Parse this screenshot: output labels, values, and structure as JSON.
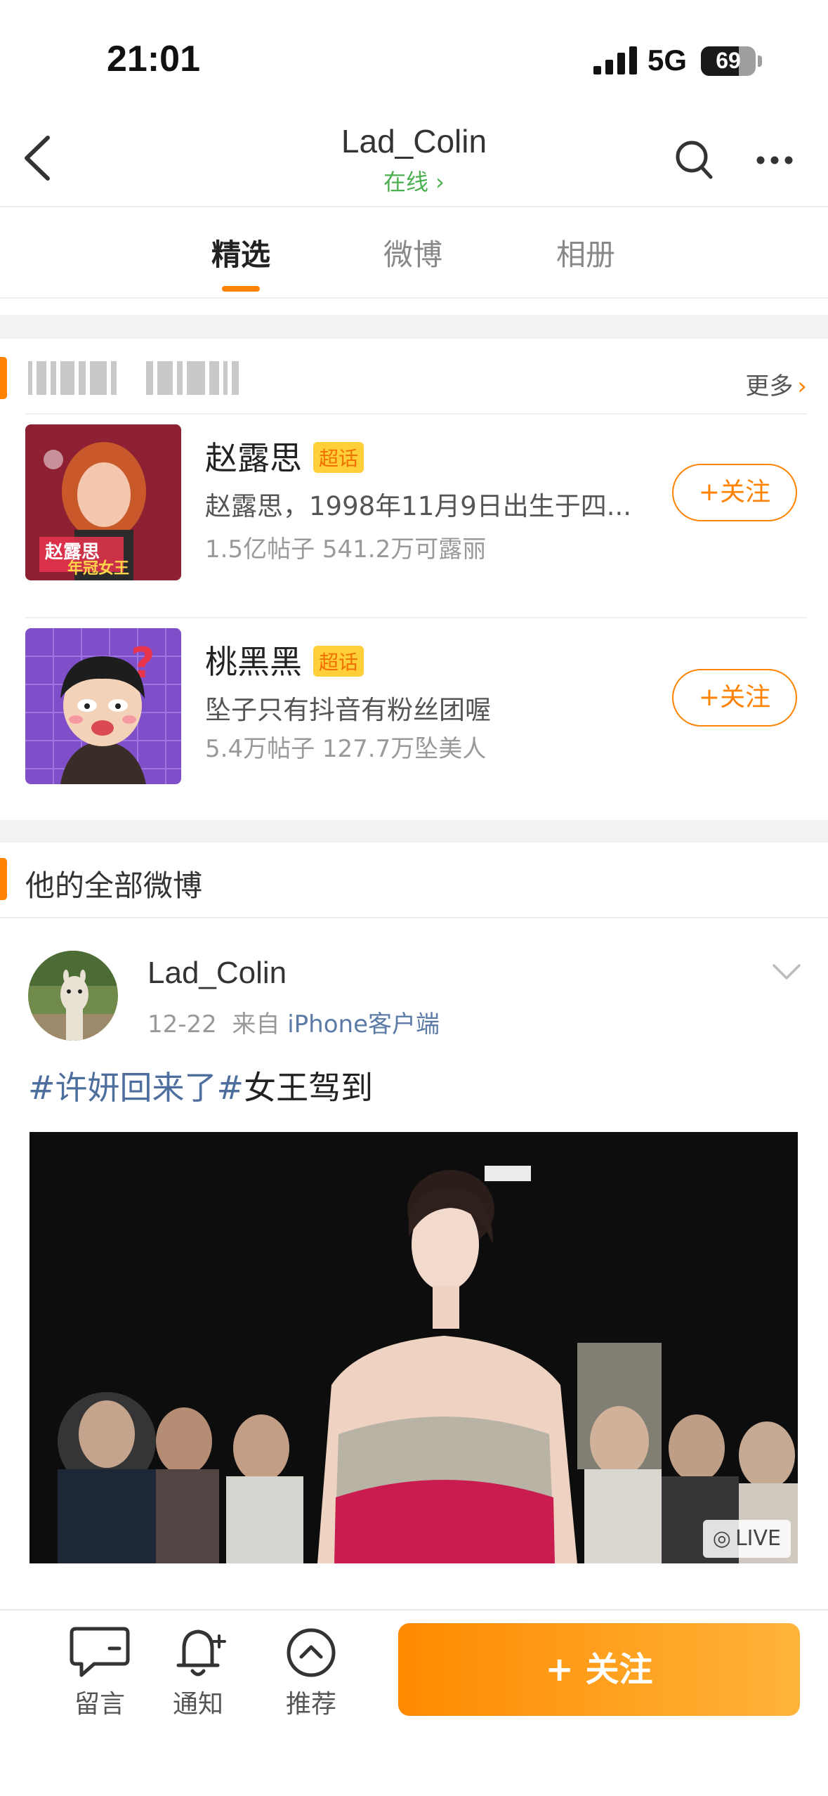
{
  "status_bar": {
    "time": "21:01",
    "network": "5G",
    "battery": "69",
    "battery_level": 0.69
  },
  "header": {
    "title": "Lad_Colin",
    "status": "在线 ›"
  },
  "tabs": [
    {
      "label": "精选",
      "active": true
    },
    {
      "label": "微博",
      "active": false
    },
    {
      "label": "相册",
      "active": false
    }
  ],
  "super_topics": {
    "more_label": "更多",
    "items": [
      {
        "name": "赵露思",
        "badge": "超话",
        "description": "赵露思，1998年11月9日出生于四...",
        "stats": "1.5亿帖子 541.2万可露丽",
        "follow_label": "+关注"
      },
      {
        "name": "桃黑黑",
        "badge": "超话",
        "description": "坠子只有抖音有粉丝团喔",
        "stats": "5.4万帖子 127.7万坠美人",
        "follow_label": "+关注"
      }
    ]
  },
  "all_posts_title": "他的全部微博",
  "post": {
    "username": "Lad_Colin",
    "date": "12-22",
    "source_prefix": "来自",
    "source": "iPhone客户端",
    "hashtag": "#许妍回来了#",
    "text": "女王驾到",
    "live_label": "LIVE"
  },
  "bottom_bar": {
    "items": [
      {
        "label": "留言",
        "icon": "comment-icon"
      },
      {
        "label": "通知",
        "icon": "bell-plus-icon"
      },
      {
        "label": "推荐",
        "icon": "chevron-up-circle-icon"
      }
    ],
    "follow_label": "+ 关注"
  },
  "colors": {
    "accent": "#ff8200",
    "online": "#4caf50",
    "link": "#4e6f9e"
  }
}
